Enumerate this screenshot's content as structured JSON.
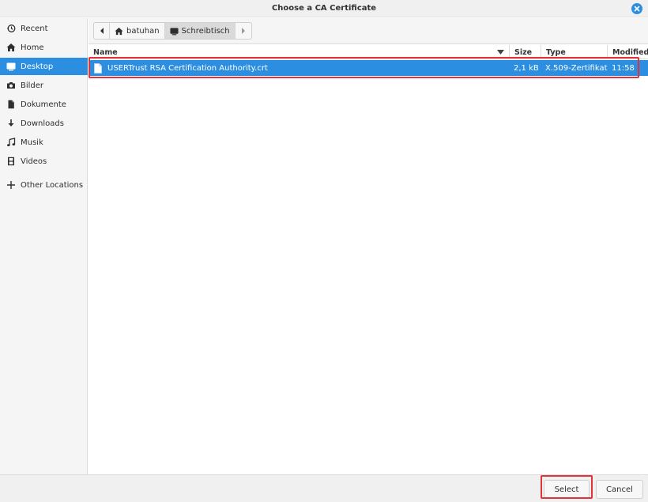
{
  "dialog": {
    "title": "Choose a CA Certificate"
  },
  "colors": {
    "accent": "#2b8ee0",
    "highlight": "#e0333a"
  },
  "sidebar": {
    "items": [
      {
        "label": "Recent",
        "icon": "recent-icon"
      },
      {
        "label": "Home",
        "icon": "home-icon"
      },
      {
        "label": "Desktop",
        "icon": "desktop-icon",
        "selected": true
      },
      {
        "label": "Bilder",
        "icon": "camera-icon"
      },
      {
        "label": "Dokumente",
        "icon": "document-icon"
      },
      {
        "label": "Downloads",
        "icon": "download-icon"
      },
      {
        "label": "Musik",
        "icon": "music-icon"
      },
      {
        "label": "Videos",
        "icon": "film-icon"
      },
      {
        "label": "Other Locations",
        "icon": "plus-icon"
      }
    ]
  },
  "pathbar": {
    "crumbs": [
      {
        "label": "batuhan",
        "icon": "home-icon"
      },
      {
        "label": "Schreibtisch",
        "icon": "desktop-icon",
        "active": true
      }
    ]
  },
  "columns": {
    "name": "Name",
    "size": "Size",
    "type": "Type",
    "modified": "Modified"
  },
  "files": [
    {
      "name": "USERTrust RSA Certification Authority.crt",
      "size": "2,1 kB",
      "type": "X.509-Zertifikat",
      "modified": "11:58",
      "selected": true
    }
  ],
  "footer": {
    "select_label": "Select",
    "cancel_label": "Cancel"
  }
}
